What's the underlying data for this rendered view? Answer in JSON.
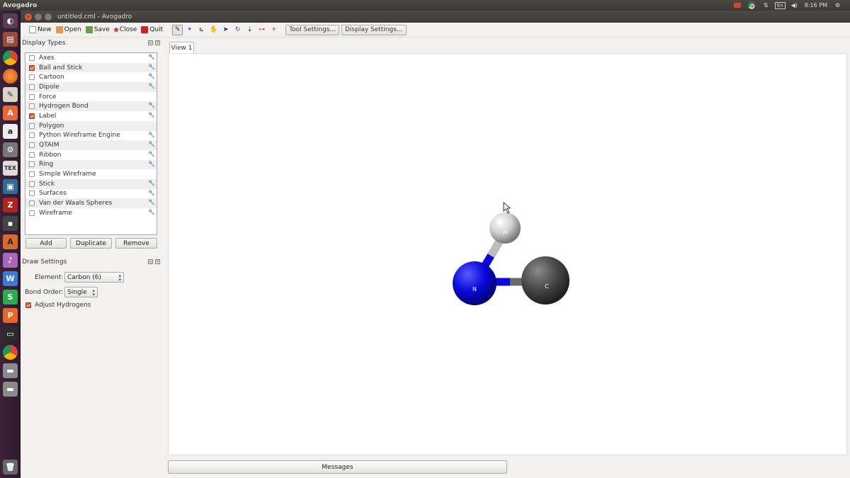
{
  "system_panel": {
    "app_name": "Avogadro",
    "keyboard": "En",
    "time": "8:16 PM"
  },
  "window": {
    "title": "untitled.cml - Avogadro"
  },
  "toolbar": {
    "new": "New",
    "open": "Open",
    "save": "Save",
    "close": "Close",
    "quit": "Quit",
    "tool_settings": "Tool Settings...",
    "display_settings": "Display Settings..."
  },
  "display_types": {
    "title": "Display Types",
    "items": [
      {
        "label": "Axes",
        "checked": false,
        "configurable": true
      },
      {
        "label": "Ball and Stick",
        "checked": true,
        "configurable": true
      },
      {
        "label": "Cartoon",
        "checked": false,
        "configurable": true
      },
      {
        "label": "Dipole",
        "checked": false,
        "configurable": true
      },
      {
        "label": "Force",
        "checked": false,
        "configurable": false
      },
      {
        "label": "Hydrogen Bond",
        "checked": false,
        "configurable": true
      },
      {
        "label": "Label",
        "checked": true,
        "configurable": true
      },
      {
        "label": "Polygon",
        "checked": false,
        "configurable": false
      },
      {
        "label": "Python Wireframe Engine",
        "checked": false,
        "configurable": true
      },
      {
        "label": "QTAIM",
        "checked": false,
        "configurable": true
      },
      {
        "label": "Ribbon",
        "checked": false,
        "configurable": true
      },
      {
        "label": "Ring",
        "checked": false,
        "configurable": true
      },
      {
        "label": "Simple Wireframe",
        "checked": false,
        "configurable": false
      },
      {
        "label": "Stick",
        "checked": false,
        "configurable": true
      },
      {
        "label": "Surfaces",
        "checked": false,
        "configurable": true
      },
      {
        "label": "Van der Waals Spheres",
        "checked": false,
        "configurable": true
      },
      {
        "label": "Wireframe",
        "checked": false,
        "configurable": true
      }
    ],
    "add": "Add",
    "duplicate": "Duplicate",
    "remove": "Remove"
  },
  "draw_settings": {
    "title": "Draw Settings",
    "element_label": "Element:",
    "element_value": "Carbon (6)",
    "bond_order_label": "Bond Order:",
    "bond_order_value": "Single",
    "adjust_hydrogens": "Adjust Hydrogens",
    "adjust_hydrogens_checked": true
  },
  "view": {
    "tab": "View 1",
    "atoms": [
      {
        "symbol": "H",
        "color": "#e8e8e8"
      },
      {
        "symbol": "N",
        "color": "#0a0adc"
      },
      {
        "symbol": "C",
        "color": "#505050"
      }
    ]
  },
  "messages": "Messages"
}
